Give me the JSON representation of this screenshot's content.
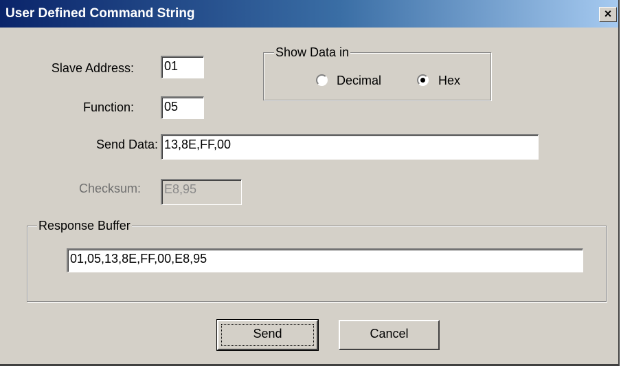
{
  "window": {
    "title": "User Defined Command String",
    "close_glyph": "×"
  },
  "form": {
    "slave_address": {
      "label": "Slave Address:",
      "value": "01"
    },
    "function": {
      "label": "Function:",
      "value": "05"
    },
    "send_data": {
      "label": "Send Data:",
      "value": "13,8E,FF,00"
    },
    "checksum": {
      "label": "Checksum:",
      "value": "E8,95"
    }
  },
  "show_data": {
    "title": "Show Data in",
    "options": [
      {
        "label": "Decimal",
        "selected": false
      },
      {
        "label": "Hex",
        "selected": true
      }
    ]
  },
  "response": {
    "title": "Response Buffer",
    "value": "01,05,13,8E,FF,00,E8,95"
  },
  "buttons": {
    "send": "Send",
    "cancel": "Cancel"
  },
  "colors": {
    "title_bar_start": "#0a246a",
    "title_bar_end": "#a6caf0",
    "dialog_face": "#d4d0c8"
  }
}
